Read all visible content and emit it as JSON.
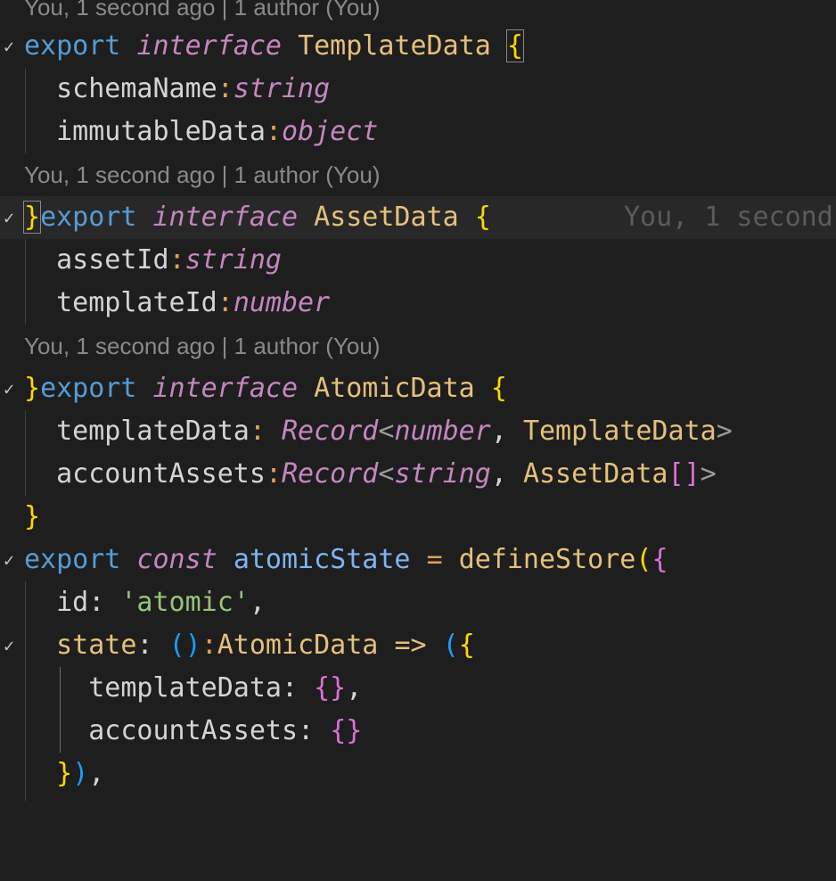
{
  "blame": {
    "top_partial": "You, 1 second ago | 1 author (You)",
    "asset_lens": "You, 1 second ago | 1 author (You)",
    "atomic_lens": "You, 1 second ago | 1 author (You)",
    "inline": "You, 1 second"
  },
  "code": {
    "kw_export": "export",
    "kw_interface": "interface",
    "kw_const": "const",
    "template_data_name": "TemplateData",
    "asset_data_name": "AssetData",
    "atomic_data_name": "AtomicData",
    "open_brace": "{",
    "close_brace": "}",
    "schema_name": "schemaName",
    "immutable_data": "immutableData",
    "asset_id": "assetId",
    "template_id": "templateId",
    "template_data_prop": "templateData",
    "account_assets_prop": "accountAssets",
    "t_string": "string",
    "t_object": "object",
    "t_number": "number",
    "t_record": "Record",
    "colon": ":",
    "colon_space": ": ",
    "comma_space": ", ",
    "comma": ",",
    "lt": "<",
    "gt": ">",
    "array_brackets": "[]",
    "atomic_state": "atomicState",
    "equals": "=",
    "define_store": "defineStore",
    "open_paren": "(",
    "close_paren": ")",
    "id_key": "id",
    "id_value": "'atomic'",
    "state_key": "state",
    "empty_parens": "()",
    "arrow": "=>",
    "empty_object": "{}"
  }
}
